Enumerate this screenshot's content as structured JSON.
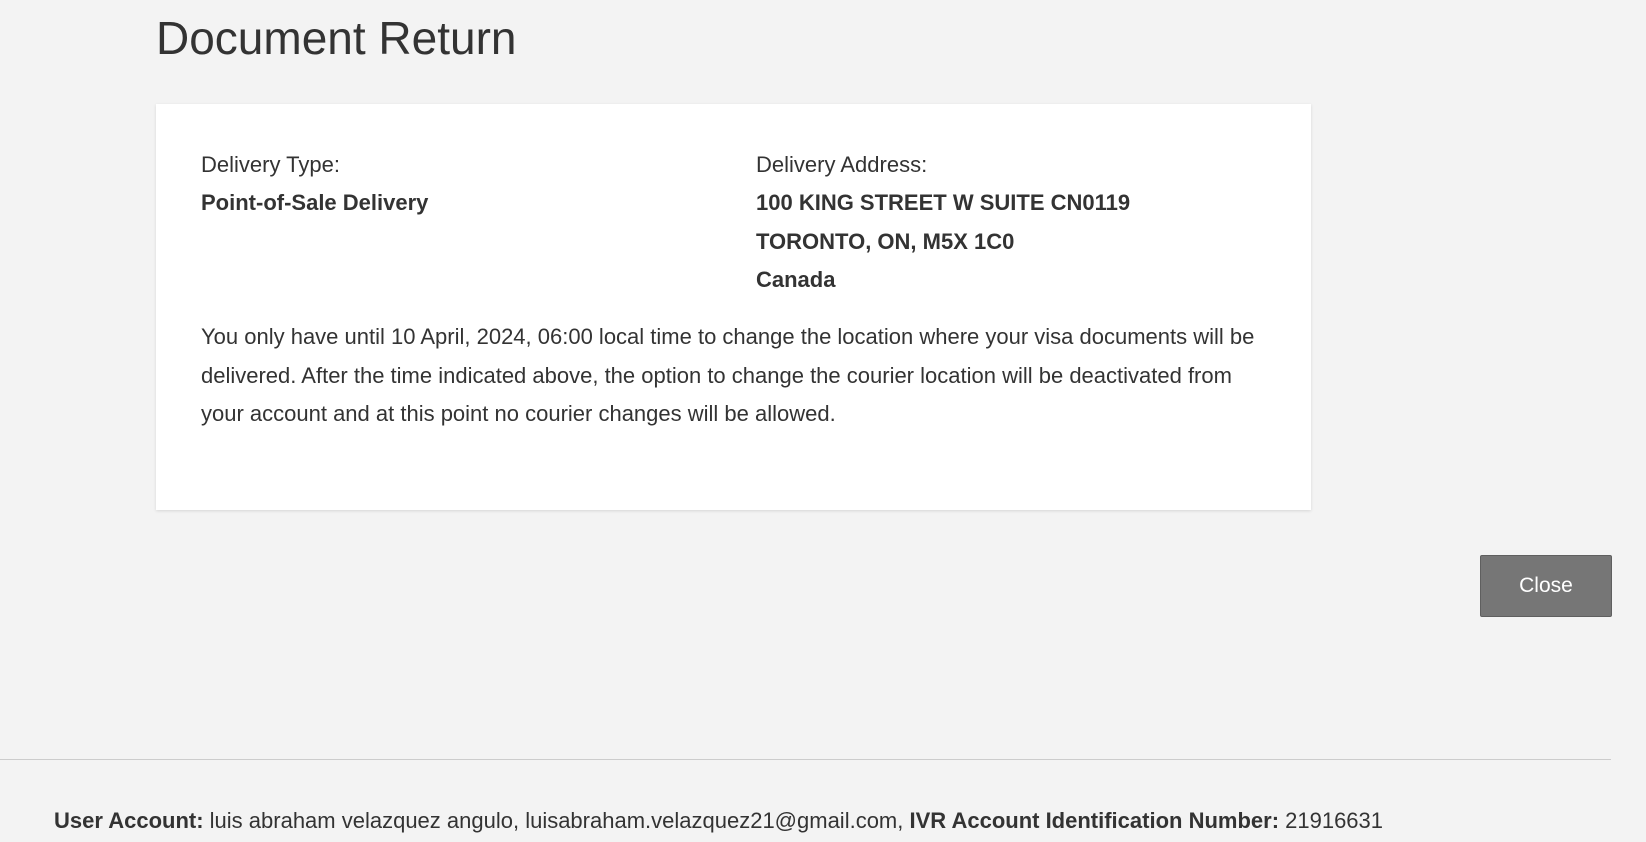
{
  "page": {
    "title": "Document Return"
  },
  "delivery": {
    "type_label": "Delivery Type:",
    "type_value": "Point-of-Sale Delivery",
    "address_label": "Delivery Address:",
    "address_lines": [
      "100 KING STREET W SUITE CN0119",
      "TORONTO, ON, M5X 1C0",
      "Canada"
    ],
    "notice": "You only have until 10 April, 2024, 06:00 local time to change the location where your visa documents will be delivered. After the time indicated above, the option to change the courier location will be deactivated from your account and at this point no courier changes will be allowed."
  },
  "actions": {
    "close_label": "Close"
  },
  "footer": {
    "user_account_label": "User Account:",
    "user_account_value": " luis abraham velazquez angulo, luisabraham.velazquez21@gmail.com, ",
    "ivr_label": "IVR Account Identification Number:",
    "ivr_value": " 21916631"
  }
}
